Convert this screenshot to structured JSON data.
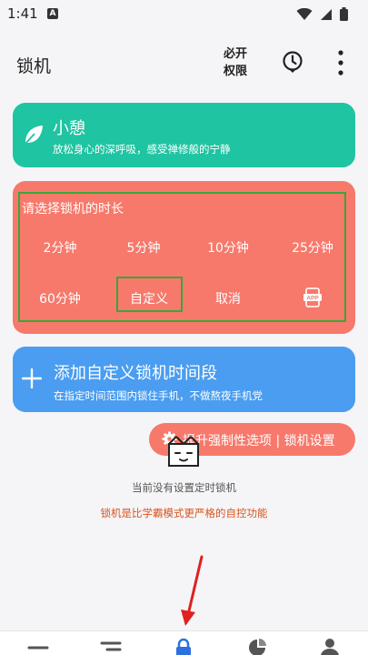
{
  "status_bar": {
    "time": "1:41",
    "notification_letter": "A"
  },
  "app_bar": {
    "title": "锁机",
    "permission_line1": "必开",
    "permission_line2": "权限"
  },
  "relax_card": {
    "title": "小憩",
    "subtitle": "放松身心的深呼吸，感受禅修般的宁静"
  },
  "lock_card": {
    "title": "请选择锁机的时长",
    "options_row1": [
      "2分钟",
      "5分钟",
      "10分钟",
      "25分钟"
    ],
    "options_row2": [
      "60分钟",
      "自定义",
      "取消"
    ],
    "app_badge": "APP"
  },
  "custom_card": {
    "title": "添加自定义锁机时间段",
    "subtitle": "在指定时间范围内锁住手机，不做熬夜手机党"
  },
  "upgrade_button": {
    "label": "提升强制性选项 | 锁机设置"
  },
  "empty_state": "当前没有设置定时锁机",
  "note": "锁机是比学霸模式更严格的自控功能",
  "colors": {
    "teal": "#1fc4a2",
    "coral": "#f7796b",
    "blue": "#4a9df0",
    "orange_text": "#d9541e",
    "highlight": "#3aa63a"
  }
}
